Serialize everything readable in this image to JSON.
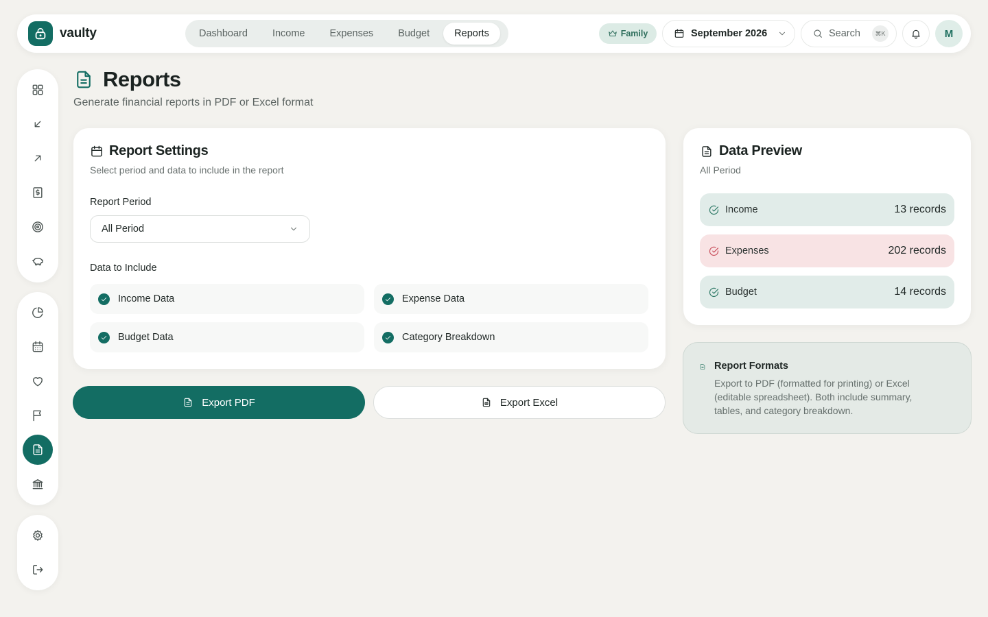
{
  "app": {
    "brand": "vaulty"
  },
  "nav": {
    "tabs": [
      {
        "label": "Dashboard",
        "active": false
      },
      {
        "label": "Income",
        "active": false
      },
      {
        "label": "Expenses",
        "active": false
      },
      {
        "label": "Budget",
        "active": false
      },
      {
        "label": "Reports",
        "active": true
      }
    ]
  },
  "header": {
    "plan_badge": "Family",
    "period": "September 2026",
    "search_label": "Search",
    "search_shortcut": "⌘K",
    "avatar_initial": "M"
  },
  "sidebar": {
    "groups": [
      [
        "grid-icon",
        "arrow-down-left-icon",
        "arrow-up-right-icon",
        "dollar-receipt-icon",
        "target-icon",
        "piggy-bank-icon"
      ],
      [
        "pie-chart-icon",
        "calendar-icon",
        "heart-icon",
        "flag-icon",
        "report-icon",
        "bank-icon"
      ],
      [
        "gear-icon",
        "logout-icon"
      ]
    ],
    "active": "report-icon"
  },
  "page": {
    "title": "Reports",
    "subtitle": "Generate financial reports in PDF or Excel format"
  },
  "settings": {
    "title": "Report Settings",
    "subtitle": "Select period and data to include in the report",
    "period_label": "Report Period",
    "period_value": "All Period",
    "include_label": "Data to Include",
    "options": [
      {
        "label": "Income Data",
        "checked": true
      },
      {
        "label": "Expense Data",
        "checked": true
      },
      {
        "label": "Budget Data",
        "checked": true
      },
      {
        "label": "Category Breakdown",
        "checked": true
      }
    ]
  },
  "actions": {
    "export_pdf": "Export PDF",
    "export_excel": "Export Excel"
  },
  "preview": {
    "title": "Data Preview",
    "subtitle": "All Period",
    "rows": [
      {
        "label": "Income",
        "count": "13 records",
        "bg": "#e1ece9",
        "icon_color": "#2f7a67"
      },
      {
        "label": "Expenses",
        "count": "202 records",
        "bg": "#f8e3e4",
        "icon_color": "#c9505d"
      },
      {
        "label": "Budget",
        "count": "14 records",
        "bg": "#e1ece9",
        "icon_color": "#2f7a67"
      }
    ]
  },
  "formats": {
    "title": "Report Formats",
    "body": "Export to PDF (formatted for printing) or Excel (editable spreadsheet). Both include summary, tables, and category breakdown."
  },
  "colors": {
    "accent": "#136d63",
    "background": "#f3f2ee",
    "danger": "#c9505d"
  }
}
